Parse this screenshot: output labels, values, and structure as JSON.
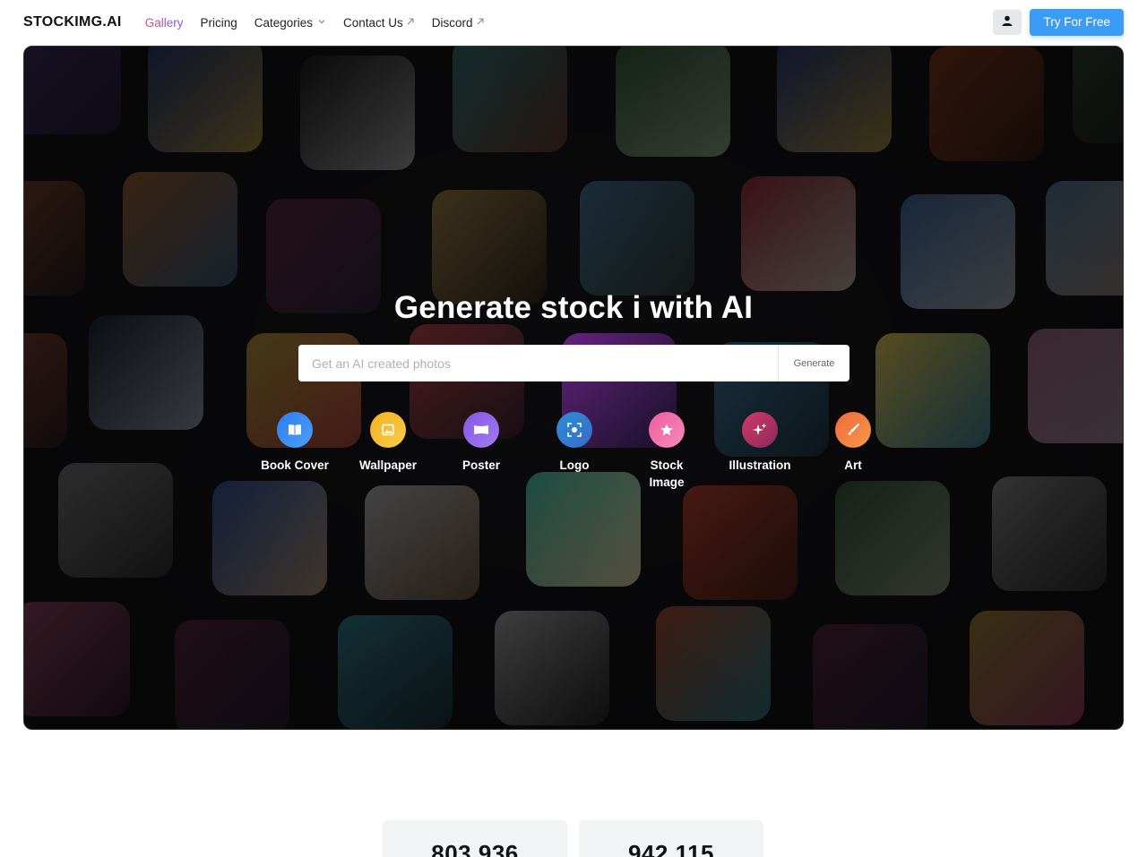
{
  "nav": {
    "logo": "STOCKIMG.AI",
    "links": [
      {
        "label": "Gallery"
      },
      {
        "label": "Pricing"
      },
      {
        "label": "Categories"
      },
      {
        "label": "Contact Us"
      },
      {
        "label": "Discord"
      }
    ],
    "cta_label": "Try For Free"
  },
  "hero": {
    "title": "Generate stock i  with AI",
    "search_placeholder": "Get an AI created photos",
    "generate_label": "Generate",
    "categories": [
      {
        "label": "Book Cover",
        "icon": "book-icon",
        "color": "#2f7df0"
      },
      {
        "label": "Wallpaper",
        "icon": "image-icon",
        "color": "#f5b21f"
      },
      {
        "label": "Poster",
        "icon": "poster-icon",
        "color": "#8557e6"
      },
      {
        "label": "Logo",
        "icon": "focus-icon",
        "color": "#2b8fd6"
      },
      {
        "label": "Stock\nImage",
        "icon": "star-icon",
        "color": "#ec5fa0"
      },
      {
        "label": "Illustration",
        "icon": "sparkle-icon",
        "color": "#d23a6b"
      },
      {
        "label": "Art",
        "icon": "brush-icon",
        "color": "#f0693a"
      }
    ]
  },
  "stats": [
    {
      "value": "803,936"
    },
    {
      "value": "942,115"
    }
  ]
}
